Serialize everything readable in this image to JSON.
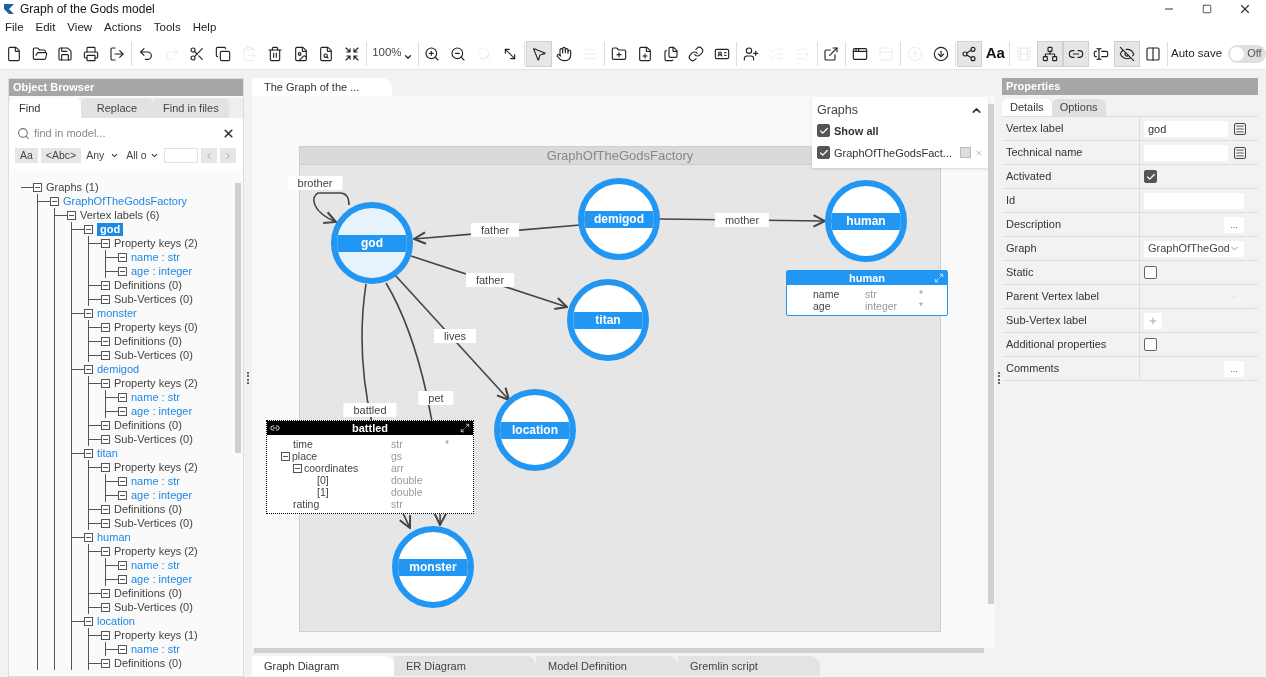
{
  "window": {
    "title": "Graph of the Gods model"
  },
  "menu": [
    "File",
    "Edit",
    "View",
    "Actions",
    "Tools",
    "Help"
  ],
  "toolbar": [
    {
      "kind": "button",
      "disabled": false,
      "pressed": false
    },
    {
      "kind": "button",
      "disabled": false,
      "pressed": false
    },
    {
      "kind": "button",
      "disabled": false,
      "pressed": false
    },
    {
      "kind": "button",
      "disabled": false,
      "pressed": false
    },
    {
      "kind": "button",
      "disabled": false,
      "pressed": false
    },
    {
      "kind": "separator"
    },
    {
      "kind": "button",
      "disabled": false,
      "pressed": false
    },
    {
      "kind": "button",
      "disabled": true,
      "pressed": false
    },
    {
      "kind": "button",
      "disabled": false,
      "pressed": false
    },
    {
      "kind": "button",
      "disabled": false,
      "pressed": false
    },
    {
      "kind": "button",
      "disabled": true,
      "pressed": false
    },
    {
      "kind": "button",
      "disabled": false,
      "pressed": false
    },
    {
      "kind": "button",
      "disabled": false,
      "pressed": false
    },
    {
      "kind": "button",
      "disabled": false,
      "pressed": false
    },
    {
      "kind": "button",
      "disabled": false,
      "pressed": false
    },
    {
      "kind": "separator"
    },
    {
      "kind": "zoom",
      "label": "100%"
    },
    {
      "kind": "separator"
    },
    {
      "kind": "button",
      "disabled": false,
      "pressed": false
    },
    {
      "kind": "button",
      "disabled": false,
      "pressed": false
    },
    {
      "kind": "button",
      "disabled": true,
      "pressed": false
    },
    {
      "kind": "button",
      "disabled": false,
      "pressed": false
    },
    {
      "kind": "separator"
    },
    {
      "kind": "button",
      "disabled": false,
      "pressed": true
    },
    {
      "kind": "button",
      "disabled": false,
      "pressed": false
    },
    {
      "kind": "button",
      "disabled": true,
      "pressed": false
    },
    {
      "kind": "separator"
    },
    {
      "kind": "button",
      "disabled": false,
      "pressed": false
    },
    {
      "kind": "button",
      "disabled": false,
      "pressed": false
    },
    {
      "kind": "button",
      "disabled": false,
      "pressed": false
    },
    {
      "kind": "button",
      "disabled": false,
      "pressed": false
    },
    {
      "kind": "button",
      "disabled": false,
      "pressed": false
    },
    {
      "kind": "separator"
    },
    {
      "kind": "button",
      "disabled": false,
      "pressed": false
    },
    {
      "kind": "button",
      "disabled": true,
      "pressed": false
    },
    {
      "kind": "button",
      "disabled": true,
      "pressed": false
    },
    {
      "kind": "separator"
    },
    {
      "kind": "button",
      "disabled": false,
      "pressed": false
    },
    {
      "kind": "separator"
    },
    {
      "kind": "button",
      "disabled": false,
      "pressed": false
    },
    {
      "kind": "button",
      "disabled": true,
      "pressed": false
    },
    {
      "kind": "separator"
    },
    {
      "kind": "button",
      "disabled": true,
      "pressed": false
    },
    {
      "kind": "button",
      "disabled": false,
      "pressed": false
    },
    {
      "kind": "separator"
    },
    {
      "kind": "button",
      "disabled": false,
      "pressed": true
    },
    {
      "kind": "glyph",
      "label": "Aa"
    },
    {
      "kind": "separator"
    },
    {
      "kind": "button",
      "disabled": true,
      "pressed": false
    },
    {
      "kind": "button",
      "disabled": false,
      "pressed": true
    },
    {
      "kind": "button",
      "disabled": false,
      "pressed": true
    },
    {
      "kind": "button",
      "disabled": false,
      "pressed": false
    },
    {
      "kind": "button",
      "disabled": false,
      "pressed": true
    },
    {
      "kind": "button",
      "disabled": false,
      "pressed": false
    },
    {
      "kind": "separator"
    }
  ],
  "auto_save": {
    "label": "Auto save",
    "on": false,
    "state_text": "Off"
  },
  "object_browser": {
    "title": "Object Browser",
    "tabs": [
      {
        "label": "Find",
        "selected": true
      },
      {
        "label": "Replace",
        "selected": false
      },
      {
        "label": "Find in files",
        "selected": false
      }
    ],
    "search": {
      "placeholder": "find in model..."
    },
    "toggles": [
      "Aa",
      "<Abc>"
    ],
    "dropdowns": [
      "Any",
      "All o"
    ],
    "tree": [
      {
        "label": "Graphs (1)",
        "kind": "folder",
        "expanded": true,
        "selected": false,
        "children": [
          {
            "label": "GraphOfTheGodsFactory",
            "kind": "link",
            "expanded": true,
            "selected": false,
            "children": [
              {
                "label": "Vertex labels (6)",
                "kind": "folder",
                "expanded": true,
                "selected": false,
                "children": [
                  {
                    "label": "god",
                    "kind": "link",
                    "expanded": true,
                    "selected": true,
                    "children": [
                      {
                        "label": "Property keys (2)",
                        "kind": "folder",
                        "expanded": true,
                        "selected": false,
                        "children": [
                          {
                            "label": "name : str",
                            "kind": "link",
                            "expanded": true,
                            "selected": false
                          },
                          {
                            "label": "age : integer",
                            "kind": "link",
                            "expanded": true,
                            "selected": false
                          }
                        ]
                      },
                      {
                        "label": "Definitions (0)",
                        "kind": "folder",
                        "expanded": true,
                        "selected": false
                      },
                      {
                        "label": "Sub-Vertices (0)",
                        "kind": "folder",
                        "expanded": true,
                        "selected": false
                      }
                    ]
                  },
                  {
                    "label": "monster",
                    "kind": "link",
                    "expanded": true,
                    "selected": false,
                    "children": [
                      {
                        "label": "Property keys (0)",
                        "kind": "folder",
                        "expanded": true,
                        "selected": false
                      },
                      {
                        "label": "Definitions (0)",
                        "kind": "folder",
                        "expanded": true,
                        "selected": false
                      },
                      {
                        "label": "Sub-Vertices (0)",
                        "kind": "folder",
                        "expanded": true,
                        "selected": false
                      }
                    ]
                  },
                  {
                    "label": "demigod",
                    "kind": "link",
                    "expanded": true,
                    "selected": false,
                    "children": [
                      {
                        "label": "Property keys (2)",
                        "kind": "folder",
                        "expanded": true,
                        "selected": false,
                        "children": [
                          {
                            "label": "name : str",
                            "kind": "link",
                            "expanded": true,
                            "selected": false
                          },
                          {
                            "label": "age : integer",
                            "kind": "link",
                            "expanded": true,
                            "selected": false
                          }
                        ]
                      },
                      {
                        "label": "Definitions (0)",
                        "kind": "folder",
                        "expanded": true,
                        "selected": false
                      },
                      {
                        "label": "Sub-Vertices (0)",
                        "kind": "folder",
                        "expanded": true,
                        "selected": false
                      }
                    ]
                  },
                  {
                    "label": "titan",
                    "kind": "link",
                    "expanded": true,
                    "selected": false,
                    "children": [
                      {
                        "label": "Property keys (2)",
                        "kind": "folder",
                        "expanded": true,
                        "selected": false,
                        "children": [
                          {
                            "label": "name : str",
                            "kind": "link",
                            "expanded": true,
                            "selected": false
                          },
                          {
                            "label": "age : integer",
                            "kind": "link",
                            "expanded": true,
                            "selected": false
                          }
                        ]
                      },
                      {
                        "label": "Definitions (0)",
                        "kind": "folder",
                        "expanded": true,
                        "selected": false
                      },
                      {
                        "label": "Sub-Vertices (0)",
                        "kind": "folder",
                        "expanded": true,
                        "selected": false
                      }
                    ]
                  },
                  {
                    "label": "human",
                    "kind": "link",
                    "expanded": true,
                    "selected": false,
                    "children": [
                      {
                        "label": "Property keys (2)",
                        "kind": "folder",
                        "expanded": true,
                        "selected": false,
                        "children": [
                          {
                            "label": "name : str",
                            "kind": "link",
                            "expanded": true,
                            "selected": false
                          },
                          {
                            "label": "age : integer",
                            "kind": "link",
                            "expanded": true,
                            "selected": false
                          }
                        ]
                      },
                      {
                        "label": "Definitions (0)",
                        "kind": "folder",
                        "expanded": true,
                        "selected": false
                      },
                      {
                        "label": "Sub-Vertices (0)",
                        "kind": "folder",
                        "expanded": true,
                        "selected": false
                      }
                    ]
                  },
                  {
                    "label": "location",
                    "kind": "link",
                    "expanded": true,
                    "selected": false,
                    "children": [
                      {
                        "label": "Property keys (1)",
                        "kind": "folder",
                        "expanded": true,
                        "selected": false,
                        "children": [
                          {
                            "label": "name : str",
                            "kind": "link",
                            "expanded": true,
                            "selected": false
                          }
                        ]
                      },
                      {
                        "label": "Definitions (0)",
                        "kind": "folder",
                        "expanded": true,
                        "selected": false
                      }
                    ]
                  }
                ]
              }
            ]
          }
        ]
      }
    ]
  },
  "document_tab": {
    "label": "The Graph of the ..."
  },
  "diagram": {
    "frame_title": "GraphOfTheGodsFactory",
    "vertices": [
      {
        "label": "god",
        "selected": true
      },
      {
        "label": "demigod",
        "selected": false
      },
      {
        "label": "human",
        "selected": false
      },
      {
        "label": "titan",
        "selected": false
      },
      {
        "label": "location",
        "selected": false
      },
      {
        "label": "monster",
        "selected": false
      }
    ],
    "edges": [
      {
        "label": "brother"
      },
      {
        "label": "father"
      },
      {
        "label": "mother"
      },
      {
        "label": "father"
      },
      {
        "label": "lives"
      },
      {
        "label": "battled"
      },
      {
        "label": "pet"
      }
    ],
    "detail_panels": [
      {
        "kind": "vertex",
        "title": "human",
        "rows": [
          {
            "name": "name",
            "type": "str",
            "suffix": "*"
          },
          {
            "name": "age",
            "type": "integer",
            "suffix": "*"
          }
        ]
      },
      {
        "kind": "edge",
        "title": "battled",
        "rows": [
          {
            "name": "time",
            "type": "str",
            "suffix": "*"
          },
          {
            "name": "place",
            "type": "gs",
            "expanded": true,
            "children": [
              {
                "name": "coordinates",
                "type": "arr",
                "expanded": true,
                "children": [
                  {
                    "name": "[0]",
                    "type": "double"
                  },
                  {
                    "name": "[1]",
                    "type": "double"
                  }
                ]
              }
            ]
          },
          {
            "name": "rating",
            "type": "str"
          }
        ]
      }
    ],
    "graphs_overlay": {
      "title": "Graphs",
      "expanded": true,
      "items": [
        {
          "kind": "all",
          "label": "Show all",
          "checked": true
        },
        {
          "kind": "graph",
          "label": "GraphOfTheGodsFact...",
          "checked": true
        }
      ]
    }
  },
  "bottom_tabs": [
    {
      "label": "Graph Diagram",
      "selected": true
    },
    {
      "label": "ER Diagram",
      "selected": false
    },
    {
      "label": "Model Definition",
      "selected": false
    },
    {
      "label": "Gremlin script",
      "selected": false
    }
  ],
  "properties": {
    "title": "Properties",
    "tabs": [
      {
        "label": "Details",
        "selected": true
      },
      {
        "label": "Options",
        "selected": false
      }
    ],
    "rows": [
      {
        "label": "Vertex label",
        "kind": "input-menu",
        "value": "god"
      },
      {
        "label": "Technical name",
        "kind": "input-menu"
      },
      {
        "label": "Activated",
        "kind": "checkbox",
        "checked": true
      },
      {
        "label": "Id",
        "kind": "input"
      },
      {
        "label": "Description",
        "kind": "ellipsis",
        "more_label": "..."
      },
      {
        "label": "Graph",
        "kind": "select",
        "value": "GraphOfTheGod",
        "disabled": false
      },
      {
        "label": "Static",
        "kind": "checkbox",
        "checked": false
      },
      {
        "label": "Parent Vertex label",
        "kind": "select",
        "disabled": true
      },
      {
        "label": "Sub-Vertex label",
        "kind": "add"
      },
      {
        "label": "Additional properties",
        "kind": "checkbox",
        "checked": false
      },
      {
        "label": "Comments",
        "kind": "ellipsis",
        "more_label": "..."
      }
    ]
  }
}
